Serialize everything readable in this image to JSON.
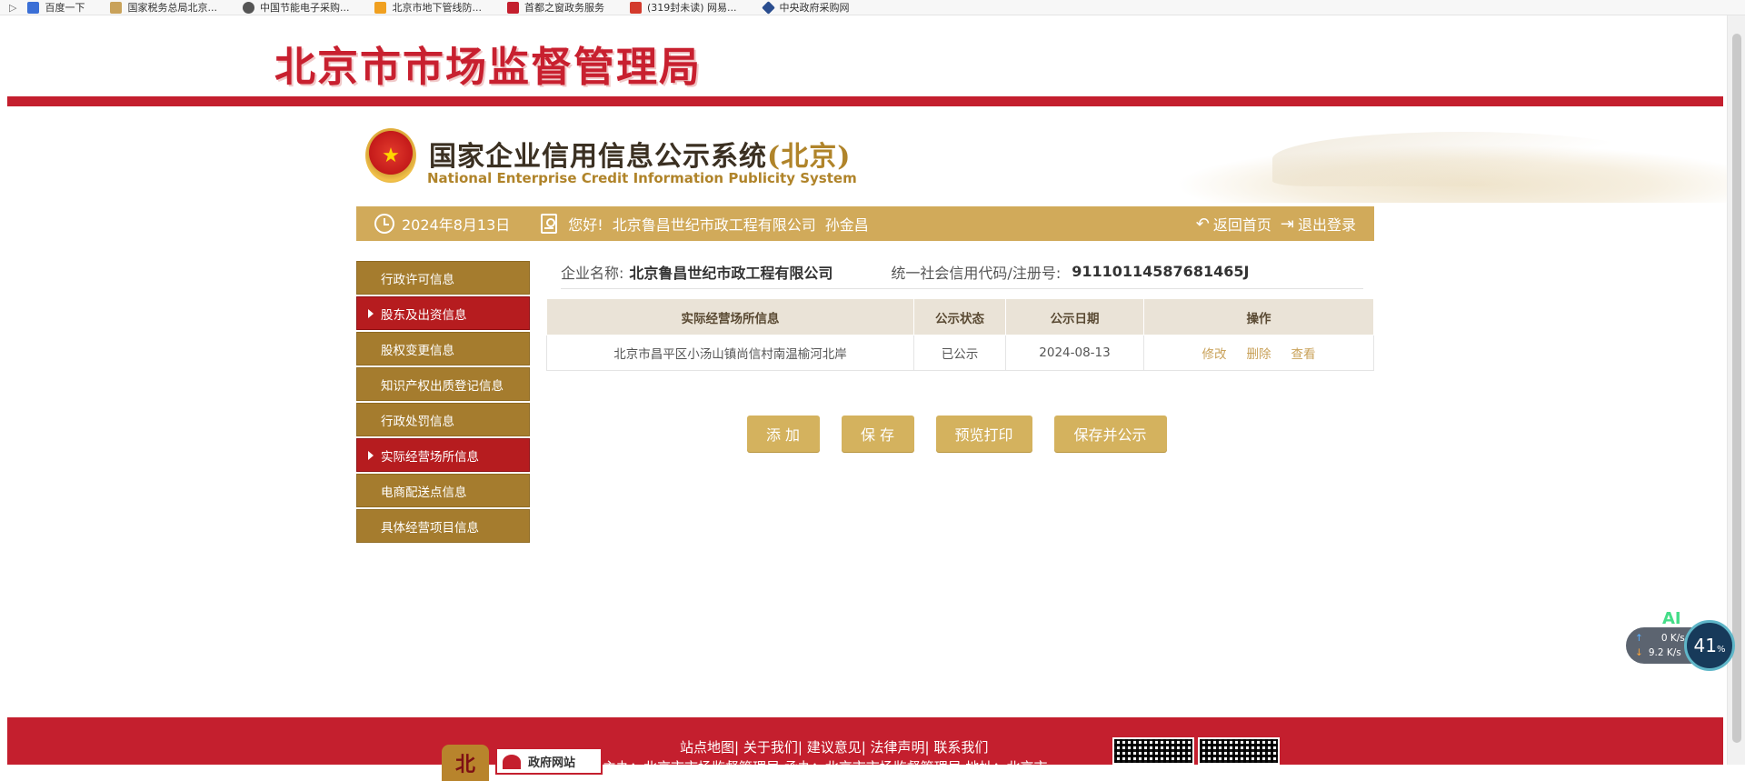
{
  "bookmarks": [
    {
      "label": "百度一下",
      "color": "#3b6fd6"
    },
    {
      "label": "国家税务总局北京...",
      "color": "#c9a25a"
    },
    {
      "label": "中国节能电子采购...",
      "color": "#555555"
    },
    {
      "label": "北京市地下管线防...",
      "color": "#f0a020"
    },
    {
      "label": "首都之窗政务服务",
      "color": "#c41f2e"
    },
    {
      "label": "(319封未读) 网易...",
      "color": "#d33a2c"
    },
    {
      "label": "中央政府采购网",
      "color": "#2a4d8f"
    }
  ],
  "header": {
    "bureau_title": "北京市市场监督管理局",
    "system_title_cn": "国家企业信用信息公示系统",
    "system_title_region": "(北京)",
    "system_title_en": "National Enterprise Credit Information Publicity System"
  },
  "info_bar": {
    "date": "2024年8月13日",
    "greeting": "您好!",
    "company": "北京鲁昌世纪市政工程有限公司",
    "user": "孙金昌",
    "home_label": "返回首页",
    "logout_label": "退出登录"
  },
  "sidebar": {
    "items": [
      {
        "label": "行政许可信息",
        "active": false
      },
      {
        "label": "股东及出资信息",
        "active": true
      },
      {
        "label": "股权变更信息",
        "active": false
      },
      {
        "label": "知识产权出质登记信息",
        "active": false
      },
      {
        "label": "行政处罚信息",
        "active": false
      },
      {
        "label": "实际经营场所信息",
        "active": true
      },
      {
        "label": "电商配送点信息",
        "active": false
      },
      {
        "label": "具体经营项目信息",
        "active": false
      }
    ]
  },
  "main": {
    "company_name_label": "企业名称:",
    "company_name": "北京鲁昌世纪市政工程有限公司",
    "credit_code_label": "统一社会信用代码/注册号:",
    "credit_code": "91110114587681465J",
    "table": {
      "headers": [
        "实际经营场所信息",
        "公示状态",
        "公示日期",
        "操作"
      ],
      "rows": [
        {
          "address": "北京市昌平区小汤山镇尚信村南温榆河北岸",
          "status": "已公示",
          "date": "2024-08-13",
          "actions": [
            "修改",
            "删除",
            "查看"
          ]
        }
      ]
    },
    "buttons": {
      "add": "添 加",
      "save": "保 存",
      "preview": "预览打印",
      "save_publish": "保存并公示"
    }
  },
  "net_widget": {
    "ai": "AI",
    "up": "0",
    "down": "9.2",
    "unit": "K/s",
    "percent": "41",
    "percent_sign": "%"
  },
  "footer": {
    "links": [
      "站点地图",
      "关于我们",
      "建议意见",
      "法律声明",
      "联系我们"
    ],
    "emblem_char": "北",
    "gov_badge": "政府网站",
    "sub_text": "主办：北京市市场监督管理局  承办：北京市市场监督管理局  地址：北京市"
  },
  "colors": {
    "brand_red": "#c41f2e",
    "gold": "#d1aa5a",
    "sidebar_gold": "#a57c2e",
    "sidebar_active": "#b61c1f",
    "button_gold": "#d4b25e"
  }
}
